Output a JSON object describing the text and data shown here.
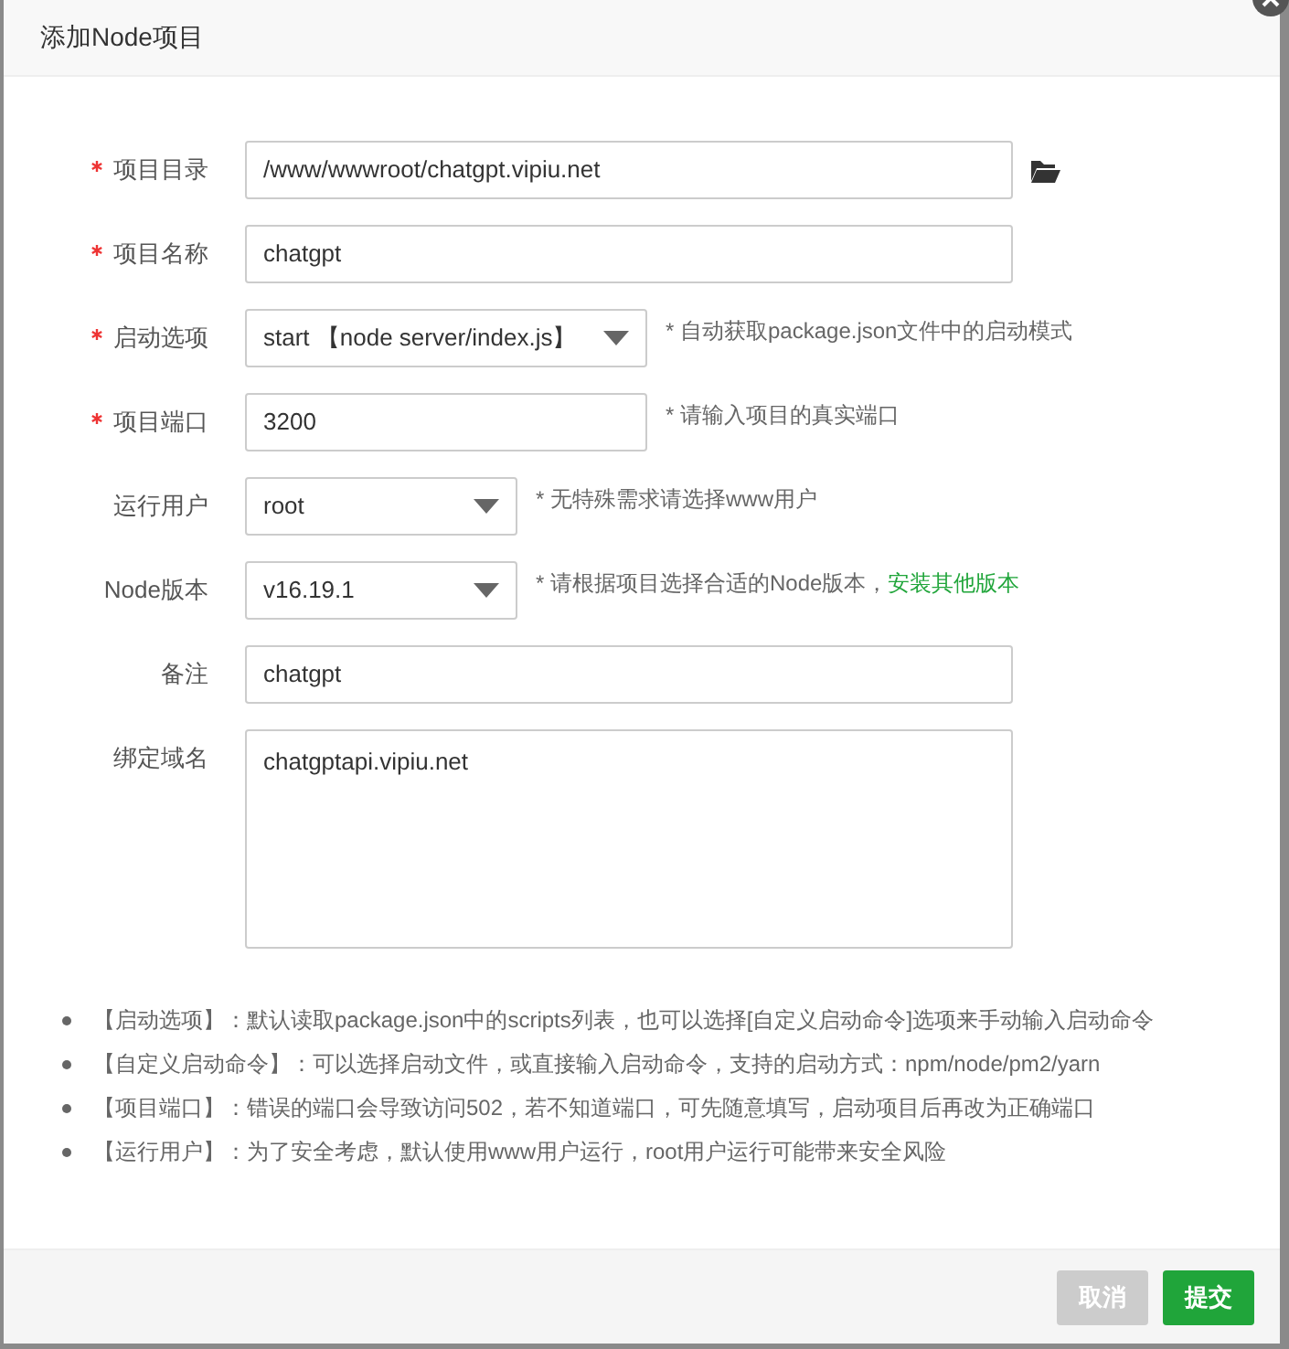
{
  "dialog": {
    "title": "添加Node项目"
  },
  "fields": [
    {
      "label": "项目目录",
      "required": true,
      "kind": "path",
      "value": "/www/wwwroot/chatgpt.vipiu.net"
    },
    {
      "label": "项目名称",
      "required": true,
      "kind": "text",
      "value": "chatgpt"
    },
    {
      "label": "启动选项",
      "required": true,
      "kind": "select",
      "value": "start 【node server/index.js】",
      "hint": "* 自动获取package.json文件中的启动模式"
    },
    {
      "label": "项目端口",
      "required": true,
      "kind": "text",
      "value": "3200",
      "hint": "* 请输入项目的真实端口"
    },
    {
      "label": "运行用户",
      "required": false,
      "kind": "select",
      "value": "root",
      "hint": "* 无特殊需求请选择www用户"
    },
    {
      "label": "Node版本",
      "required": false,
      "kind": "select",
      "value": "v16.19.1",
      "hint": "* 请根据项目选择合适的Node版本，",
      "hint_link": "安装其他版本"
    },
    {
      "label": "备注",
      "required": false,
      "kind": "text",
      "value": "chatgpt"
    },
    {
      "label": "绑定域名",
      "required": false,
      "kind": "textarea",
      "value": "chatgptapi.vipiu.net"
    }
  ],
  "notes": [
    "【启动选项】：默认读取package.json中的scripts列表，也可以选择[自定义启动命令]选项来手动输入启动命令",
    "【自定义启动命令】：可以选择启动文件，或直接输入启动命令，支持的启动方式：npm/node/pm2/yarn",
    "【项目端口】：错误的端口会导致访问502，若不知道端口，可先随意填写，启动项目后再改为正确端口",
    "【运行用户】：为了安全考虑，默认使用www用户运行，root用户运行可能带来安全风险"
  ],
  "buttons": [
    {
      "label": "取消",
      "disabled": true
    },
    {
      "label": "提交",
      "disabled": false
    }
  ]
}
